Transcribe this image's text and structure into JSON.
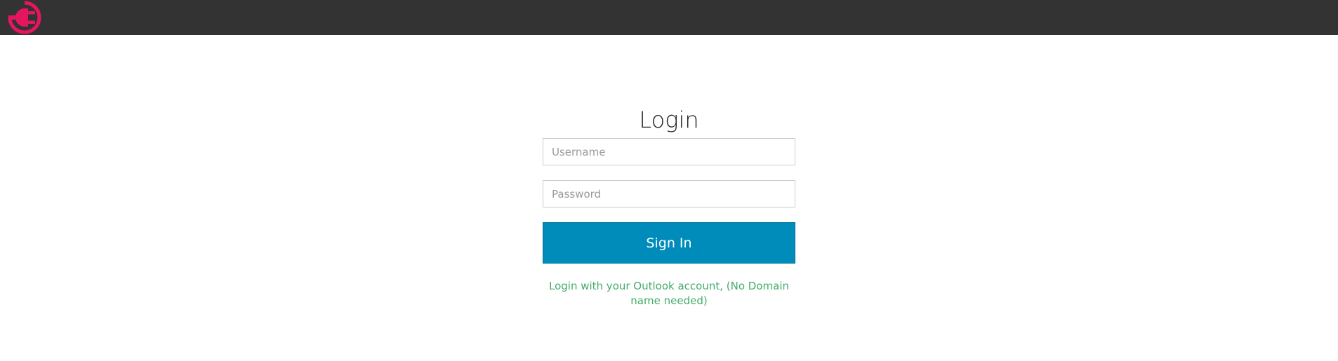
{
  "header": {
    "logo_icon": "power-plug-logo-icon",
    "background_color": "#333333",
    "logo_color": "#e5155f"
  },
  "login": {
    "title": "Login",
    "username": {
      "placeholder": "Username",
      "value": ""
    },
    "password": {
      "placeholder": "Password",
      "value": ""
    },
    "signin_label": "Sign In",
    "note": "Login with your Outlook account, (No Domain name needed)"
  },
  "colors": {
    "button": "#008cba",
    "note_text": "#43ac6a"
  }
}
